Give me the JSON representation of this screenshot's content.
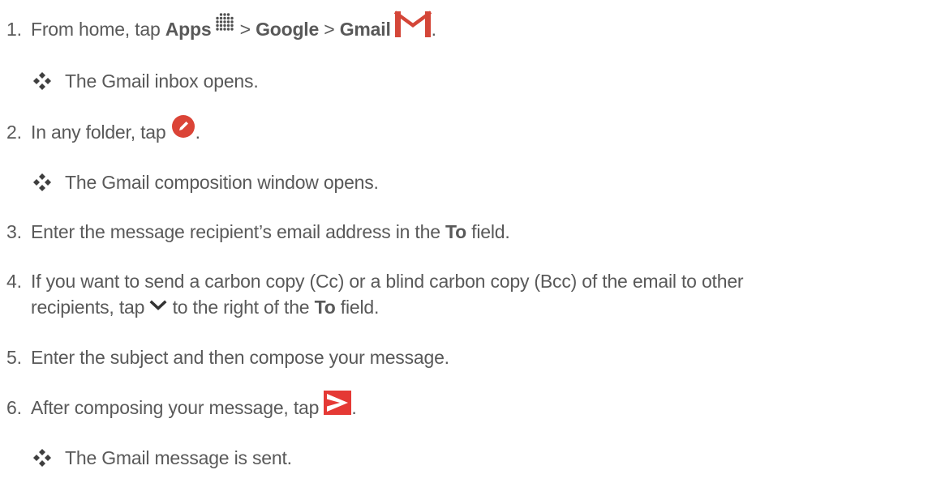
{
  "steps": [
    {
      "number": "1.",
      "text_a": "From home, tap ",
      "bold_a": "Apps",
      "text_b": " > ",
      "bold_b": "Google",
      "text_c": " > ",
      "bold_c": "Gmail",
      "text_d": "."
    },
    {
      "number": "2.",
      "text_a": "In any folder, tap ",
      "text_b": "."
    },
    {
      "number": "3.",
      "text_a": "Enter the message recipient’s email address in the ",
      "bold_a": "To",
      "text_b": " field."
    },
    {
      "number": "4.",
      "line1": "If you want to send a carbon copy (Cc) or a blind carbon copy (Bcc) of the email to other",
      "text_a": "recipients, tap ",
      "text_b": " to the right of the ",
      "bold_a": "To",
      "text_c": " field."
    },
    {
      "number": "5.",
      "text_a": "Enter the subject and then compose your message."
    },
    {
      "number": "6.",
      "text_a": "After composing your message, tap ",
      "text_b": "."
    }
  ],
  "results": [
    "The Gmail inbox opens.",
    "The Gmail composition window opens.",
    "The Gmail message is sent."
  ],
  "icons": {
    "apps": "apps-grid-icon",
    "gmail": "gmail-icon",
    "compose": "compose-pencil-icon",
    "chevron": "chevron-down-icon",
    "send": "send-icon",
    "bullet": "diamond-bullet-icon"
  },
  "colors": {
    "text": "#595959",
    "gmail_red": "#d44638",
    "compose_red": "#db4437",
    "send_red": "#e53935"
  }
}
